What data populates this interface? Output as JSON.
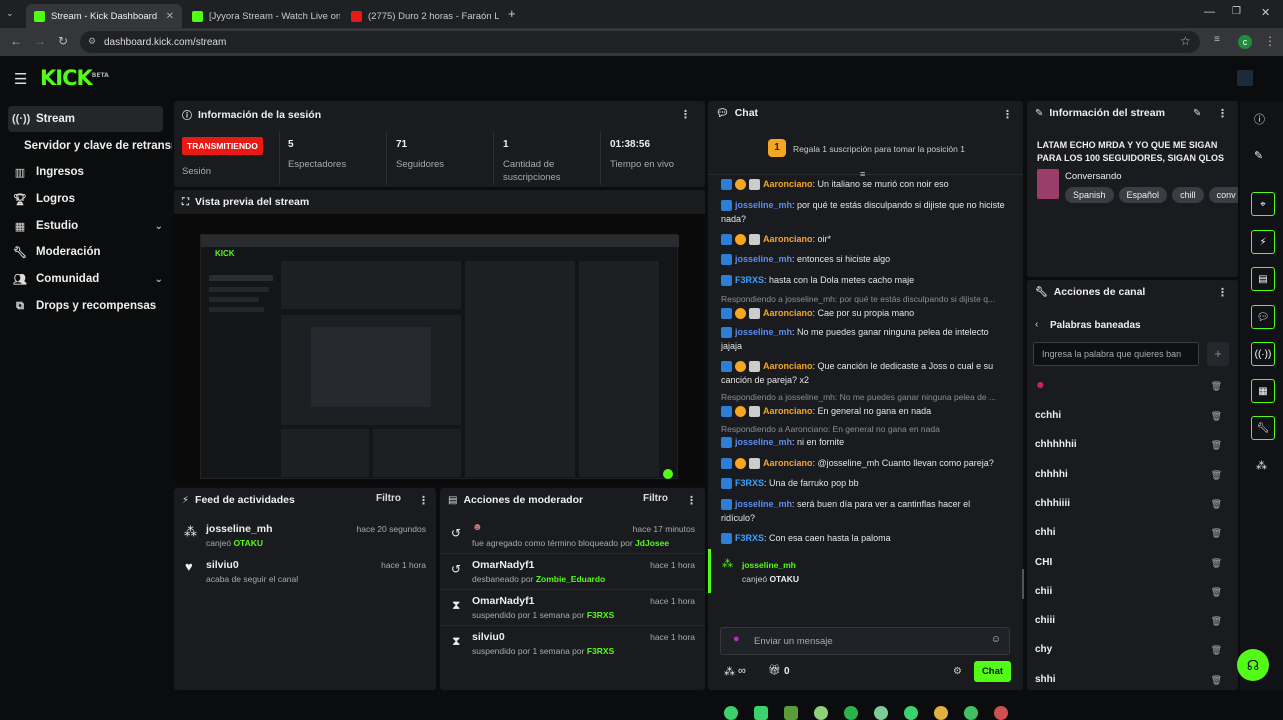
{
  "browser": {
    "tabs": [
      {
        "title": "Stream - Kick Dashboard",
        "color": "#53fc18"
      },
      {
        "title": "[Jyyora Stream - Watch Live on",
        "color": "#53fc18"
      },
      {
        "title": "(2775) Duro 2 horas - Faraón L...",
        "color": "#e91916"
      }
    ],
    "url": "dashboard.kick.com/stream",
    "profile_initial": "c"
  },
  "brand": {
    "logo": "KICK",
    "beta": "BETA",
    "accent": "#53fc18"
  },
  "sidebar": {
    "items": [
      {
        "label": "Stream",
        "icon": "broadcast-icon"
      },
      {
        "label": "Servidor y clave de retransm",
        "icon": ""
      },
      {
        "label": "Ingresos",
        "icon": "chart-icon"
      },
      {
        "label": "Logros",
        "icon": "trophy-icon"
      },
      {
        "label": "Estudio",
        "icon": "layout-icon"
      },
      {
        "label": "Moderación",
        "icon": "wrench-icon"
      },
      {
        "label": "Comunidad",
        "icon": "community-icon"
      },
      {
        "label": "Drops y recompensas",
        "icon": "gift-icon"
      }
    ]
  },
  "session": {
    "title": "Información de la sesión",
    "status": "TRANSMITIENDO",
    "status_label": "Sesión",
    "stats": [
      {
        "value": "5",
        "label": "Espectadores"
      },
      {
        "value": "71",
        "label": "Seguidores"
      },
      {
        "value": "1",
        "label": "Cantidad de suscripciones"
      },
      {
        "value": "01:38:56",
        "label": "Tiempo en vivo"
      }
    ]
  },
  "preview": {
    "title": "Vista previa del stream"
  },
  "activity": {
    "title": "Feed de actividades",
    "filter": "Filtro",
    "items": [
      {
        "name": "josseline_mh",
        "action": "canjeó",
        "reward": "OTAKU",
        "time": "hace 20 segundos"
      },
      {
        "name": "silviu0",
        "action": "acaba de seguir el canal",
        "reward": "",
        "time": "hace 1 hora"
      }
    ]
  },
  "modactions": {
    "title": "Acciones de moderador",
    "filter": "Filtro",
    "items": [
      {
        "name": "",
        "action": "fue agregado como término bloqueado por",
        "by": "JdJosee",
        "time": "hace 17 minutos"
      },
      {
        "name": "OmarNadyf1",
        "action": "desbaneado por",
        "by": "Zombie_Eduardo",
        "time": "hace 1 hora"
      },
      {
        "name": "OmarNadyf1",
        "action": "suspendido por 1 semana por",
        "by": "F3RXS",
        "time": "hace 1 hora"
      },
      {
        "name": "silviu0",
        "action": "suspendido por 1 semana por",
        "by": "F3RXS",
        "time": "hace 1 hora"
      }
    ]
  },
  "chat": {
    "title": "Chat",
    "gift_banner": "Regala 1 suscripción para tomar la posición 1",
    "gift_number": "1",
    "messages": [
      {
        "user": "Aaronciano",
        "color": "#f5a623",
        "text": "Un italiano se murió con noir eso",
        "reply": ""
      },
      {
        "user": "josseline_mh",
        "color": "#5b8def",
        "text": "por qué te estás disculpando si dijiste que no hiciste nada?",
        "reply": ""
      },
      {
        "user": "Aaronciano",
        "color": "#f5a623",
        "text": "oir*",
        "reply": ""
      },
      {
        "user": "josseline_mh",
        "color": "#5b8def",
        "text": "entonces si hiciste algo",
        "reply": ""
      },
      {
        "user": "F3RXS",
        "color": "#3ba1ff",
        "text": "hasta con la Dola metes cacho maje",
        "reply": ""
      },
      {
        "user": "Aaronciano",
        "color": "#f5a623",
        "text": "Cae por su propia mano",
        "reply": "Respondiendo a josseline_mh: por qué te estás disculpando si dijiste q..."
      },
      {
        "user": "josseline_mh",
        "color": "#5b8def",
        "text": "No me puedes ganar ninguna pelea de intelecto jajaja",
        "reply": ""
      },
      {
        "user": "Aaronciano",
        "color": "#f5a623",
        "text": "Que canción le dedicaste a Joss o cual e su canción de pareja? x2",
        "reply": ""
      },
      {
        "user": "Aaronciano",
        "color": "#f5a623",
        "text": "En general no gana en nada",
        "reply": "Respondiendo a josseline_mh: No me puedes ganar ninguna pelea de ..."
      },
      {
        "user": "josseline_mh",
        "color": "#5b8def",
        "text": "ni en fornite",
        "reply": "Respondiendo a Aaronciano: En general no gana en nada"
      },
      {
        "user": "Aaronciano",
        "color": "#f5a623",
        "text": "@josseline_mh Cuanto llevan como pareja?",
        "reply": ""
      },
      {
        "user": "F3RXS",
        "color": "#3ba1ff",
        "text": "Una de farruko pop bb",
        "reply": ""
      },
      {
        "user": "josseline_mh",
        "color": "#5b8def",
        "text": "será buen día para ver a cantinflas hacer el ridículo?",
        "reply": ""
      },
      {
        "user": "F3RXS",
        "color": "#3ba1ff",
        "text": "Con esa caen hasta la paloma",
        "reply": ""
      }
    ],
    "redeem": {
      "user": "josseline_mh",
      "action": "canjeó",
      "reward": "OTAKU"
    },
    "input_placeholder": "Enviar un mensaje",
    "points_value": "∞",
    "gift_count": "0",
    "send_label": "Chat"
  },
  "streaminfo": {
    "title": "Información del stream",
    "stream_title": "LATAM ECHO MRDA Y YO QUE ME SIGAN PARA LOS 100 SEGUIDORES, SIGAN QLOS",
    "category": "Conversando",
    "tags": [
      "Spanish",
      "Español",
      "chill",
      "conv"
    ]
  },
  "channel": {
    "title": "Acciones de canal",
    "section": "Palabras baneadas",
    "input_placeholder": "Ingresa la palabra que quieres ban",
    "add": "+",
    "words": [
      "cchhi",
      "chhhhhii",
      "chhhhi",
      "chhhiiii",
      "chhi",
      "CHI",
      "chii",
      "chiii",
      "chy",
      "shhi"
    ]
  }
}
